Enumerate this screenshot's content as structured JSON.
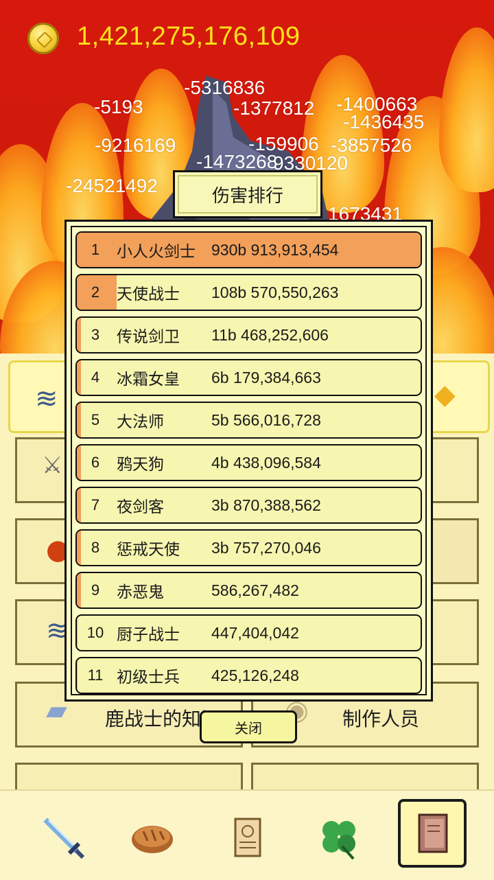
{
  "gold": {
    "amount": "1,421,275,176,109"
  },
  "damage_numbers": [
    "-5316836",
    "-5193",
    "-1377812",
    "-1400663",
    "-1436435",
    "-9216169",
    "-159906",
    "-3857526",
    "-1473268",
    "9330120",
    "-24521492",
    "1673431"
  ],
  "dialog": {
    "title": "伤害排行",
    "rows": [
      {
        "rank": "1",
        "name": "小人火剑士",
        "score": "930b 913,913,454",
        "fill": 1.0
      },
      {
        "rank": "2",
        "name": "天使战士",
        "score": "108b 570,550,263",
        "fill": 0.116
      },
      {
        "rank": "3",
        "name": "传说剑卫",
        "score": "11b 468,252,606",
        "fill": 0.012
      },
      {
        "rank": "4",
        "name": "冰霜女皇",
        "score": "6b 179,384,663",
        "fill": 0.0066
      },
      {
        "rank": "5",
        "name": "大法师",
        "score": "5b 566,016,728",
        "fill": 0.006
      },
      {
        "rank": "6",
        "name": "鸦天狗",
        "score": "4b 438,096,584",
        "fill": 0.0047
      },
      {
        "rank": "7",
        "name": "夜剑客",
        "score": "3b 870,388,562",
        "fill": 0.0041
      },
      {
        "rank": "8",
        "name": "惩戒天使",
        "score": "3b 757,270,046",
        "fill": 0.004
      },
      {
        "rank": "9",
        "name": "赤恶鬼",
        "score": "586,267,482",
        "fill": 0.0006
      },
      {
        "rank": "10",
        "name": "厨子战士",
        "score": "447,404,042",
        "fill": 0.0005
      },
      {
        "rank": "11",
        "name": "初级士兵",
        "score": "425,126,248",
        "fill": 0.0004
      }
    ],
    "close_label": "关闭"
  },
  "menu": {
    "knowledge_label": "鹿战士的知识",
    "credits_label": "制作人员"
  },
  "nav": [
    "sword-icon",
    "bread-icon",
    "scroll-icon",
    "clover-icon",
    "book-icon"
  ],
  "colors": {
    "gold_text": "#ffe21a",
    "bar": "#f2a05a",
    "row_bg": "#f6f6b0"
  }
}
